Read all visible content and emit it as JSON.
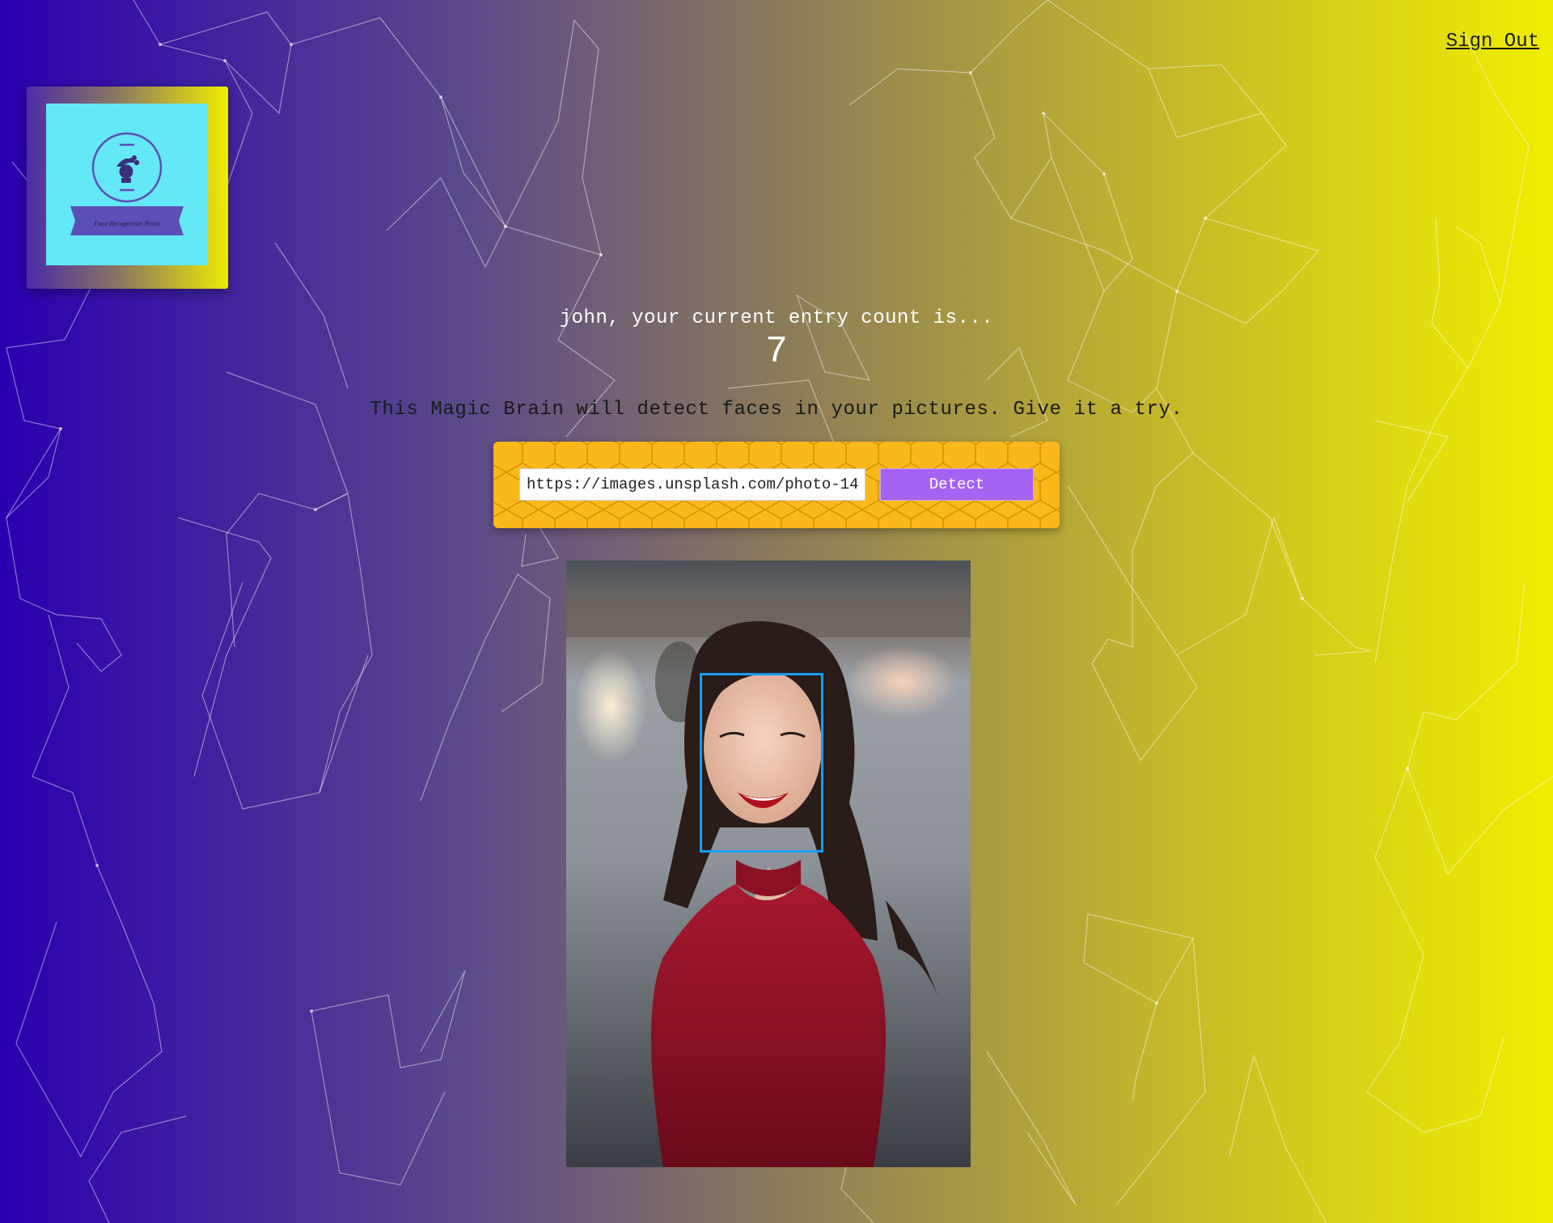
{
  "nav": {
    "sign_out_label": "Sign Out"
  },
  "logo": {
    "caption": "Face Recognition Brain",
    "icon": "brain-face-icon"
  },
  "rank": {
    "message": "john, your current entry count is...",
    "count": "7"
  },
  "description": "This Magic Brain will detect faces in your pictures. Give it a try.",
  "form": {
    "input_value": "https://images.unsplash.com/photo-14",
    "detect_label": "Detect"
  },
  "colors": {
    "form_background": "#fbb81a",
    "detect_button": "#a463f2",
    "face_box": "#149df2",
    "logo_background": "#64e8f5"
  }
}
